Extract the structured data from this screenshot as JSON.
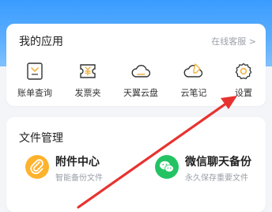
{
  "colors": {
    "header_blue": "#3a9cff",
    "card_bg": "#ffffff",
    "page_bg": "#f3f5f9",
    "icon_yellow": "#f0b341",
    "attachment_orange": "#ffb22c",
    "wechat_green": "#23c364",
    "annotation_red": "#e8322f"
  },
  "my_apps": {
    "title": "我的应用",
    "service_link": "在线客服 >",
    "items": [
      {
        "label": "账单查询",
        "icon": "bill-icon"
      },
      {
        "label": "发票夹",
        "icon": "invoice-icon"
      },
      {
        "label": "天翼云盘",
        "icon": "cloud-icon"
      },
      {
        "label": "云笔记",
        "icon": "cloud-note-icon"
      },
      {
        "label": "设置",
        "icon": "gear-icon"
      }
    ]
  },
  "file_management": {
    "title": "文件管理",
    "items": [
      {
        "name": "附件中心",
        "subtitle": "智能备份文件",
        "icon": "paperclip-icon"
      },
      {
        "name": "微信聊天备份",
        "subtitle": "永久保存重要文件",
        "icon": "wechat-icon"
      }
    ]
  },
  "annotation": {
    "type": "arrow",
    "points_to": "设置"
  }
}
